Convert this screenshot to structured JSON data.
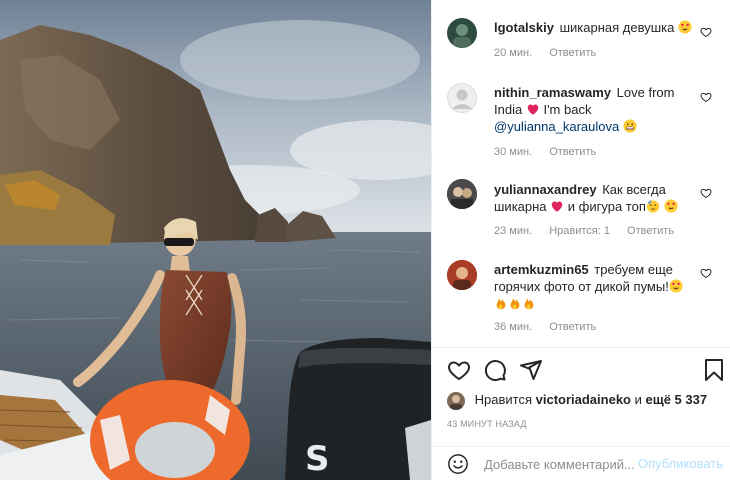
{
  "colors": {
    "link": "#00376b",
    "muted": "#8e8e8e",
    "like_red": "#ed4956",
    "post_disabled": "#b2dffc"
  },
  "comments": [
    {
      "username": "lgotalskiy",
      "text": "шикарная девушка",
      "emoji": [
        "heart-eyes"
      ],
      "time": "20 мин.",
      "reply": "Ответить"
    },
    {
      "username": "nithin_ramaswamy",
      "text_before": "Love from India",
      "text_middle": "I'm back",
      "mention": "@yulianna_karaulova",
      "emoji": [
        "red-heart",
        "grimacing"
      ],
      "time": "30 мин.",
      "reply": "Ответить"
    },
    {
      "username": "yuliannaxandrey",
      "text_before": "Как всегда шикарна",
      "text_after": "и фигура топ",
      "emoji": [
        "red-heart",
        "partying-face",
        "heart-eyes"
      ],
      "time": "23 мин.",
      "likes": "Нравится: 1",
      "reply": "Ответить"
    },
    {
      "username": "artemkuzmin65",
      "text": "требуем еще горячих фото от дикой пумы!",
      "emoji": [
        "heart-eyes",
        "fire",
        "fire",
        "fire"
      ],
      "time": "36 мин.",
      "reply": "Ответить"
    }
  ],
  "actions": {
    "icons": [
      "heart-icon",
      "comment-icon",
      "share-icon",
      "bookmark-icon"
    ]
  },
  "likes_line": {
    "prefix": "Нравится",
    "user": "victoriadaineko",
    "connector": "и",
    "others": "ещё 5 337"
  },
  "post_time": "43 минут назад",
  "composer": {
    "placeholder": "Добавьте комментарий...",
    "post_label": "Опубликовать"
  },
  "photo": {
    "motor_brand_letter": "S"
  }
}
